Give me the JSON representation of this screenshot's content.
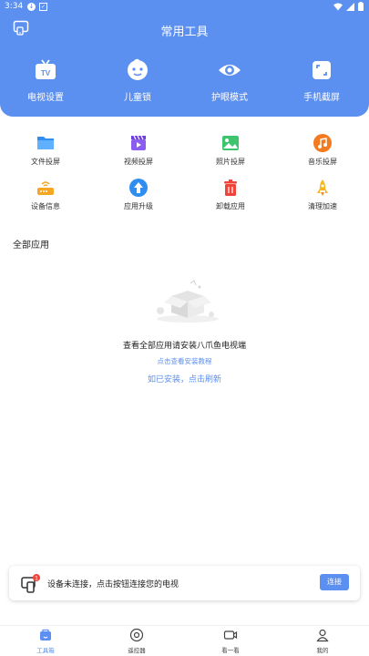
{
  "status_bar": {
    "time": "3:34"
  },
  "header": {
    "title": "常用工具"
  },
  "quick_actions": [
    {
      "label": "电视设置",
      "icon": "tv-icon"
    },
    {
      "label": "儿童锁",
      "icon": "child-face-icon"
    },
    {
      "label": "护眼模式",
      "icon": "eye-icon"
    },
    {
      "label": "手机截屏",
      "icon": "screenshot-icon"
    }
  ],
  "tools": [
    {
      "label": "文件投屏",
      "icon": "folder-icon"
    },
    {
      "label": "视频投屏",
      "icon": "video-clapper-icon"
    },
    {
      "label": "照片投屏",
      "icon": "photo-icon"
    },
    {
      "label": "音乐投屏",
      "icon": "music-icon"
    },
    {
      "label": "设备信息",
      "icon": "router-icon"
    },
    {
      "label": "应用升级",
      "icon": "upgrade-icon"
    },
    {
      "label": "卸载应用",
      "icon": "trash-icon"
    },
    {
      "label": "清理加速",
      "icon": "rocket-icon"
    }
  ],
  "all_apps": {
    "title": "全部应用",
    "empty_message": "查看全部应用请安装八爪鱼电视端",
    "tutorial_link": "点击查看安装教程",
    "refresh_link": "如已安装，点击刷新"
  },
  "connection": {
    "message": "设备未连接，点击按钮连接您的电视",
    "button": "连接",
    "badge": "1"
  },
  "tabbar": [
    {
      "label": "工具箱",
      "icon": "toolbox-icon",
      "active": true
    },
    {
      "label": "遥控器",
      "icon": "remote-icon",
      "active": false
    },
    {
      "label": "看一看",
      "icon": "video-camera-icon",
      "active": false
    },
    {
      "label": "我的",
      "icon": "user-icon",
      "active": false
    }
  ],
  "colors": {
    "primary": "#5b8ff0"
  }
}
